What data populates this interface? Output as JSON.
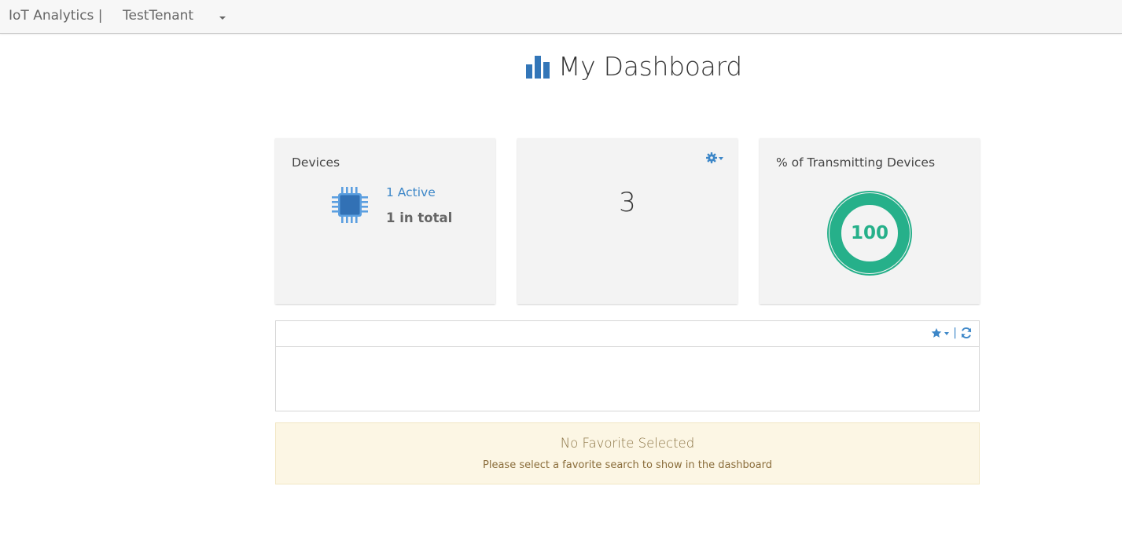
{
  "navbar": {
    "brand": "IoT Analytics |",
    "tenant": "TestTenant",
    "tenant_menu_icon": "caret-down-icon"
  },
  "page": {
    "title": "My Dashboard",
    "title_icon": "bar-chart-icon",
    "accent_color": "#3d87c8"
  },
  "cards": {
    "devices": {
      "title": "Devices",
      "icon": "chip-icon",
      "active_label": "1 Active",
      "total_label": "1 in total"
    },
    "count": {
      "settings_icon": "gear-icon",
      "value": "3"
    },
    "transmitting": {
      "title": "% of Transmitting Devices",
      "value": "100",
      "percent": 100,
      "color": "#26b08a"
    }
  },
  "favorites_panel": {
    "star_icon": "star-icon",
    "separator": "|",
    "refresh_icon": "refresh-icon"
  },
  "alert": {
    "title": "No Favorite Selected",
    "message": "Please select a favorite search to show in the dashboard",
    "background": "#fcf6e4"
  }
}
